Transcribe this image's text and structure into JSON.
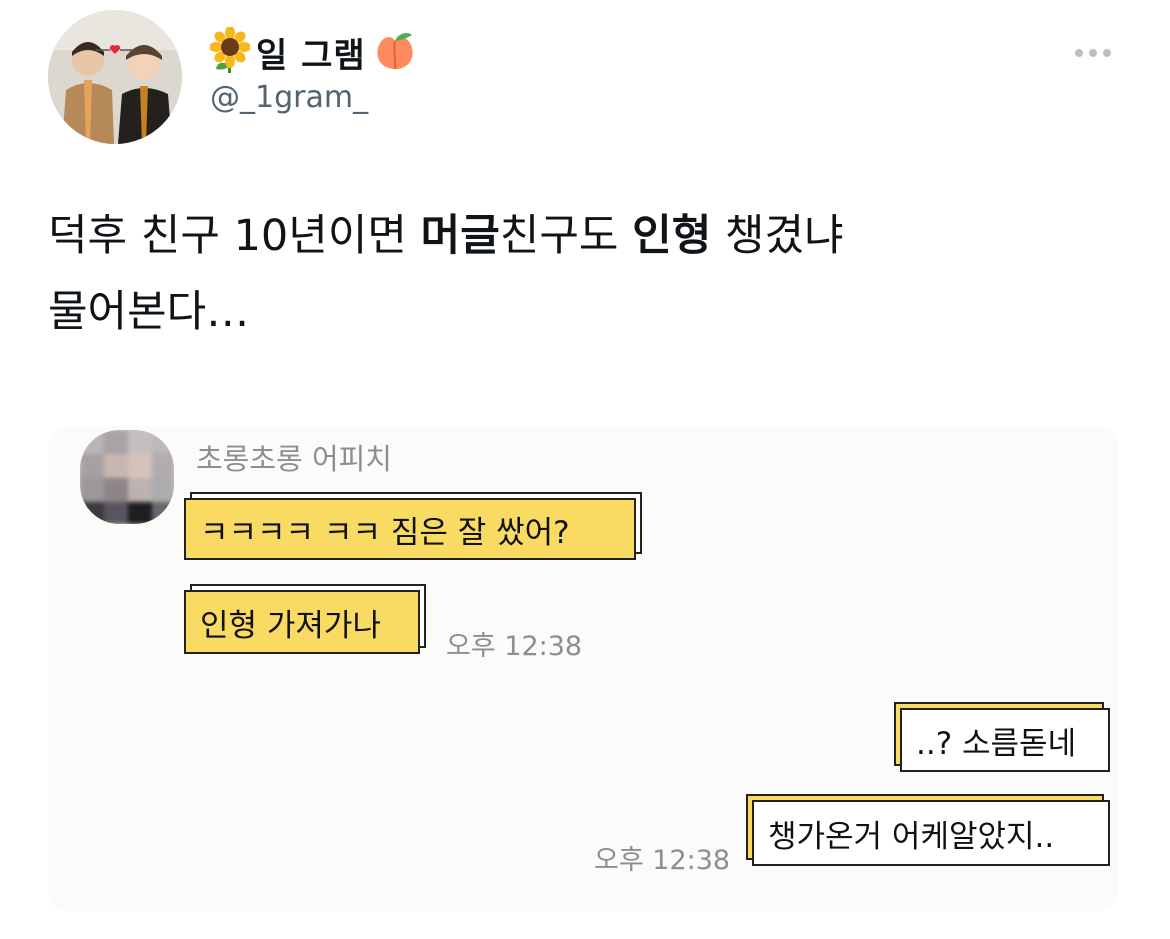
{
  "tweet": {
    "display_name": "일 그램",
    "display_name_emoji_prefix": "sunflower-icon",
    "display_name_emoji_suffix": "peach-icon",
    "handle": "@_1gram_",
    "text_parts": {
      "p1": "덕후 친구 10년이면 ",
      "p2": "머글",
      "p3": "친구도 ",
      "p4": "인형",
      "p5": " 챙겼냐",
      "p6": "물어본다…"
    },
    "more_icon": "more-dots-icon"
  },
  "chat": {
    "sender_name": "초롱초롱 어피치",
    "messages": [
      {
        "text": "ㅋㅋㅋㅋ ㅋㅋ 짐은 잘 쌌어?",
        "direction": "incoming"
      },
      {
        "text": "인형 가져가나",
        "direction": "incoming"
      },
      {
        "text": "..? 소름돋네",
        "direction": "outgoing"
      },
      {
        "text": "챙가온거 어케알았지..",
        "direction": "outgoing"
      }
    ],
    "timestamps": [
      "오후 12:38",
      "오후 12:38"
    ],
    "colors": {
      "incoming_bubble": "#f9db63",
      "outgoing_bubble": "#ffffff",
      "border": "#222222"
    }
  }
}
